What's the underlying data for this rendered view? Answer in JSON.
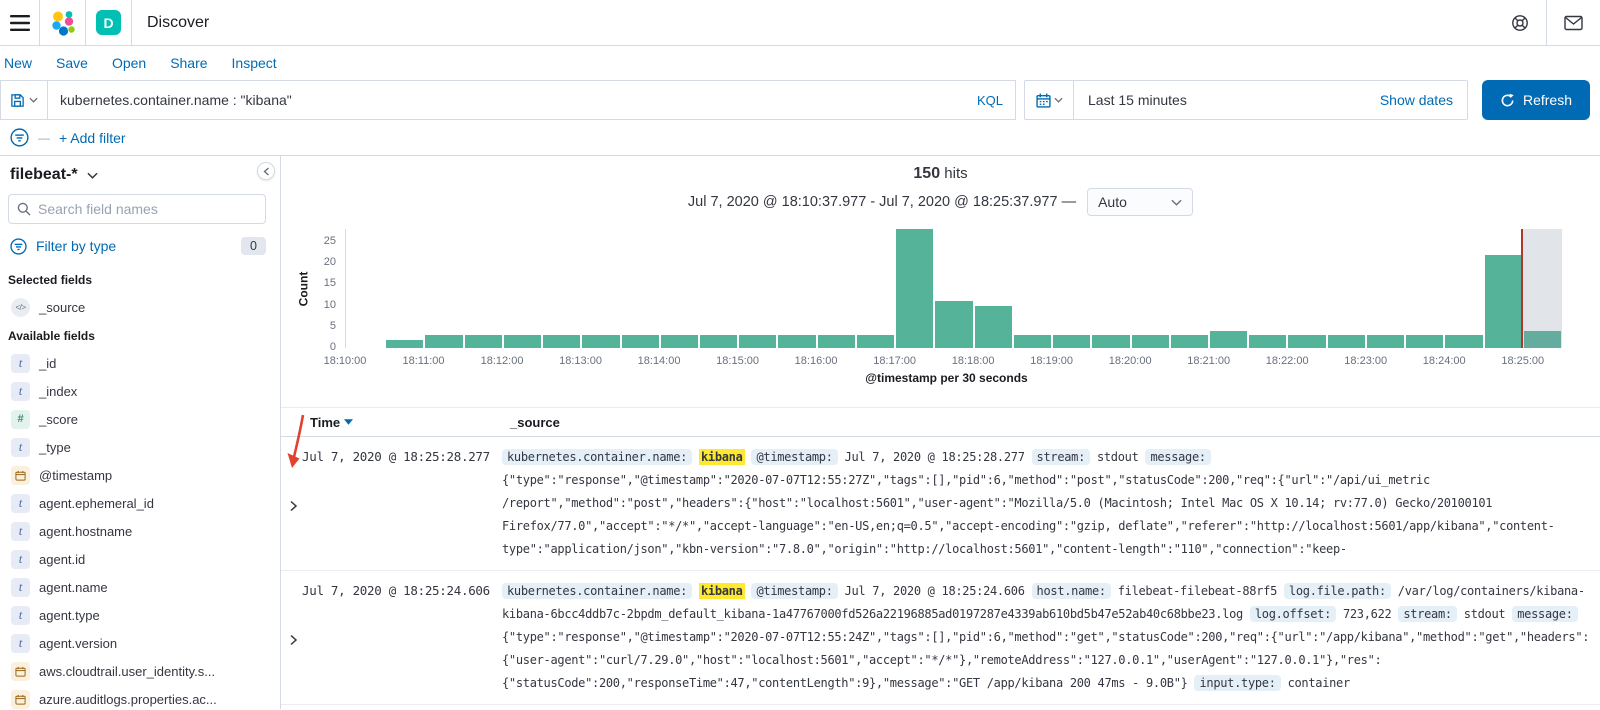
{
  "header": {
    "title": "Discover",
    "space_initial": "D"
  },
  "menubar": {
    "items": [
      "New",
      "Save",
      "Open",
      "Share",
      "Inspect"
    ]
  },
  "query_bar": {
    "query": "kubernetes.container.name : \"kibana\"",
    "language": "KQL"
  },
  "time_picker": {
    "range_label": "Last 15 minutes",
    "show_dates_label": "Show dates",
    "refresh_label": "Refresh"
  },
  "filter_bar": {
    "add_filter_label": "+ Add filter"
  },
  "sidebar": {
    "index_pattern": "filebeat-*",
    "search_placeholder": "Search field names",
    "filter_by_type_label": "Filter by type",
    "filter_count": "0",
    "selected_heading": "Selected fields",
    "selected_fields": [
      {
        "name": "_source",
        "type": "source"
      }
    ],
    "available_heading": "Available fields",
    "available_fields": [
      {
        "name": "_id",
        "type": "string"
      },
      {
        "name": "_index",
        "type": "string"
      },
      {
        "name": "_score",
        "type": "number"
      },
      {
        "name": "_type",
        "type": "string"
      },
      {
        "name": "@timestamp",
        "type": "date"
      },
      {
        "name": "agent.ephemeral_id",
        "type": "string"
      },
      {
        "name": "agent.hostname",
        "type": "string"
      },
      {
        "name": "agent.id",
        "type": "string"
      },
      {
        "name": "agent.name",
        "type": "string"
      },
      {
        "name": "agent.type",
        "type": "string"
      },
      {
        "name": "agent.version",
        "type": "string"
      },
      {
        "name": "aws.cloudtrail.user_identity.s...",
        "type": "date"
      },
      {
        "name": "azure.auditlogs.properties.ac...",
        "type": "date"
      }
    ]
  },
  "results": {
    "hits_count": "150",
    "hits_label": "hits",
    "time_range": "Jul 7, 2020 @ 18:10:37.977 - Jul 7, 2020 @ 18:25:37.977 —",
    "interval_label": "Auto"
  },
  "chart_data": {
    "type": "bar",
    "title": "150 hits",
    "xlabel": "@timestamp per 30 seconds",
    "ylabel": "Count",
    "ylim": [
      0,
      28
    ],
    "y_ticks": [
      0,
      5,
      10,
      15,
      20,
      25
    ],
    "x_domain": [
      "18:10:00",
      "18:25:30"
    ],
    "x_tick_labels": [
      "18:10:00",
      "18:11:00",
      "18:12:00",
      "18:13:00",
      "18:14:00",
      "18:15:00",
      "18:16:00",
      "18:17:00",
      "18:18:00",
      "18:19:00",
      "18:20:00",
      "18:21:00",
      "18:22:00",
      "18:23:00",
      "18:24:00",
      "18:25:00"
    ],
    "bucket_seconds": 30,
    "buckets": [
      {
        "time": "18:10:30",
        "count": 2
      },
      {
        "time": "18:11:00",
        "count": 3
      },
      {
        "time": "18:11:30",
        "count": 3
      },
      {
        "time": "18:12:00",
        "count": 3
      },
      {
        "time": "18:12:30",
        "count": 3
      },
      {
        "time": "18:13:00",
        "count": 3
      },
      {
        "time": "18:13:30",
        "count": 3
      },
      {
        "time": "18:14:00",
        "count": 3
      },
      {
        "time": "18:14:30",
        "count": 3
      },
      {
        "time": "18:15:00",
        "count": 3
      },
      {
        "time": "18:15:30",
        "count": 3
      },
      {
        "time": "18:16:00",
        "count": 3
      },
      {
        "time": "18:16:30",
        "count": 3
      },
      {
        "time": "18:17:00",
        "count": 28
      },
      {
        "time": "18:17:30",
        "count": 11
      },
      {
        "time": "18:18:00",
        "count": 10
      },
      {
        "time": "18:18:30",
        "count": 3
      },
      {
        "time": "18:19:00",
        "count": 3
      },
      {
        "time": "18:19:30",
        "count": 3
      },
      {
        "time": "18:20:00",
        "count": 3
      },
      {
        "time": "18:20:30",
        "count": 3
      },
      {
        "time": "18:21:00",
        "count": 4
      },
      {
        "time": "18:21:30",
        "count": 3
      },
      {
        "time": "18:22:00",
        "count": 3
      },
      {
        "time": "18:22:30",
        "count": 3
      },
      {
        "time": "18:23:00",
        "count": 3
      },
      {
        "time": "18:23:30",
        "count": 3
      },
      {
        "time": "18:24:00",
        "count": 3
      },
      {
        "time": "18:24:30",
        "count": 22
      },
      {
        "time": "18:25:00",
        "count": 4
      }
    ],
    "bar_color": "#54B399",
    "time_marker": "18:25:00",
    "partial_zone": [
      "18:25:00",
      "18:25:30"
    ],
    "grid": false,
    "legend": false
  },
  "table": {
    "columns": [
      "Time",
      "_source"
    ],
    "rows": [
      {
        "time": "Jul 7, 2020 @ 18:25:28.277",
        "source_lines": [
          [
            {
              "k": "badge",
              "v": "kubernetes.container.name:"
            },
            {
              "k": "txt",
              "v": " "
            },
            {
              "k": "hl",
              "v": "kibana"
            },
            {
              "k": "txt",
              "v": " "
            },
            {
              "k": "badge",
              "v": "@timestamp:"
            },
            {
              "k": "txt",
              "v": " Jul 7, 2020 @ 18:25:28.277 "
            },
            {
              "k": "badge",
              "v": "stream:"
            },
            {
              "k": "txt",
              "v": " stdout "
            },
            {
              "k": "badge",
              "v": "message:"
            }
          ],
          [
            {
              "k": "txt",
              "v": "{\"type\":\"response\",\"@timestamp\":\"2020-07-07T12:55:27Z\",\"tags\":[],\"pid\":6,\"method\":\"post\",\"statusCode\":200,\"req\":{\"url\":\"/api/ui_metric"
            }
          ],
          [
            {
              "k": "txt",
              "v": "/report\",\"method\":\"post\",\"headers\":{\"host\":\"localhost:5601\",\"user-agent\":\"Mozilla/5.0 (Macintosh; Intel Mac OS X 10.14; rv:77.0) Gecko/20100101"
            }
          ],
          [
            {
              "k": "txt",
              "v": "Firefox/77.0\",\"accept\":\"*/*\",\"accept-language\":\"en-US,en;q=0.5\",\"accept-encoding\":\"gzip, deflate\",\"referer\":\"http://localhost:5601/app/kibana\",\"content-"
            }
          ],
          [
            {
              "k": "txt",
              "v": "type\":\"application/json\",\"kbn-version\":\"7.8.0\",\"origin\":\"http://localhost:5601\",\"content-length\":\"110\",\"connection\":\"keep-"
            }
          ]
        ]
      },
      {
        "time": "Jul 7, 2020 @ 18:25:24.606",
        "source_lines": [
          [
            {
              "k": "badge",
              "v": "kubernetes.container.name:"
            },
            {
              "k": "txt",
              "v": " "
            },
            {
              "k": "hl",
              "v": "kibana"
            },
            {
              "k": "txt",
              "v": " "
            },
            {
              "k": "badge",
              "v": "@timestamp:"
            },
            {
              "k": "txt",
              "v": " Jul 7, 2020 @ 18:25:24.606 "
            },
            {
              "k": "badge",
              "v": "host.name:"
            },
            {
              "k": "txt",
              "v": " filebeat-filebeat-88rf5 "
            },
            {
              "k": "badge",
              "v": "log.file.path:"
            },
            {
              "k": "txt",
              "v": " /var/log/containers/kibana-"
            }
          ],
          [
            {
              "k": "txt",
              "v": "kibana-6bcc4ddb7c-2bpdm_default_kibana-1a47767000fd526a22196885ad0197287e4339ab610bd5b47e52ab40c68bbe23.log "
            },
            {
              "k": "badge",
              "v": "log.offset:"
            },
            {
              "k": "txt",
              "v": " 723,622 "
            },
            {
              "k": "badge",
              "v": "stream:"
            },
            {
              "k": "txt",
              "v": " stdout "
            },
            {
              "k": "badge",
              "v": "message:"
            }
          ],
          [
            {
              "k": "txt",
              "v": "{\"type\":\"response\",\"@timestamp\":\"2020-07-07T12:55:24Z\",\"tags\":[],\"pid\":6,\"method\":\"get\",\"statusCode\":200,\"req\":{\"url\":\"/app/kibana\",\"method\":\"get\",\"headers\":"
            }
          ],
          [
            {
              "k": "txt",
              "v": "{\"user-agent\":\"curl/7.29.0\",\"host\":\"localhost:5601\",\"accept\":\"*/*\"},\"remoteAddress\":\"127.0.0.1\",\"userAgent\":\"127.0.0.1\"},\"res\":"
            }
          ],
          [
            {
              "k": "txt",
              "v": "{\"statusCode\":200,\"responseTime\":47,\"contentLength\":9},\"message\":\"GET /app/kibana 200 47ms - 9.0B\"} "
            },
            {
              "k": "badge",
              "v": "input.type:"
            },
            {
              "k": "txt",
              "v": " container"
            }
          ]
        ]
      }
    ]
  },
  "colors": {
    "primary_blue": "#006BB4",
    "bar_green": "#54B399",
    "space_avatar_teal": "#00BFB3",
    "highlight_yellow": "#FFE930",
    "time_marker_red": "#B1362C",
    "annotation_arrow_red": "#E0432F",
    "border_grey": "#D3DAE6"
  }
}
